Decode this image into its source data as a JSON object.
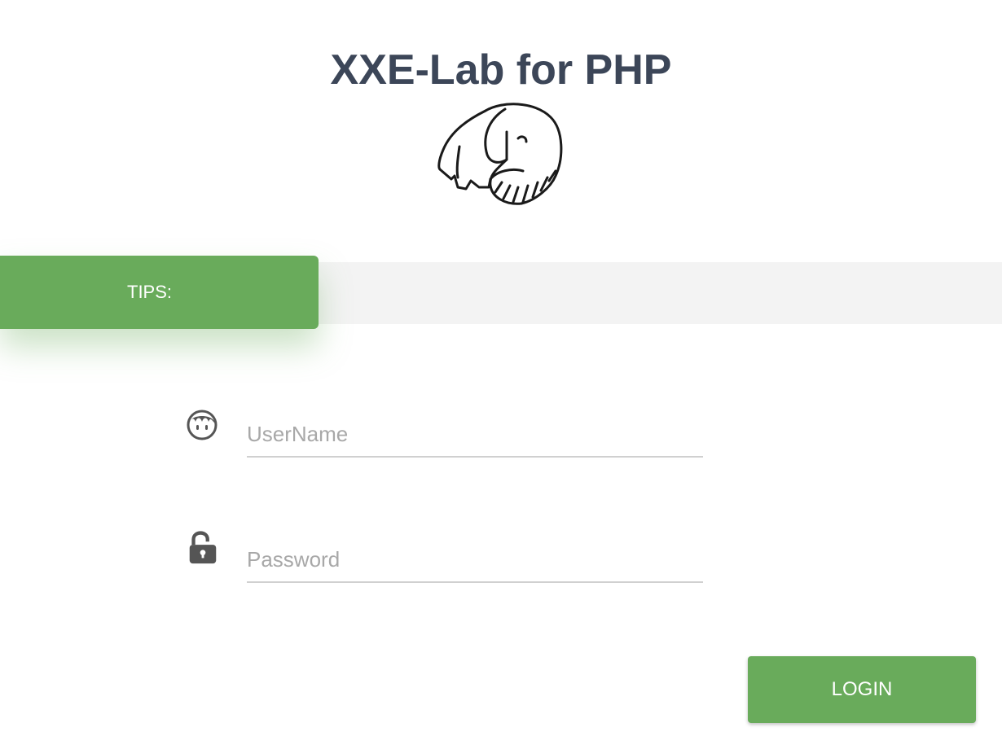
{
  "header": {
    "title": "XXE-Lab for PHP",
    "logo_icon": "php-elephant-icon"
  },
  "tips": {
    "label": "TIPS:",
    "text": ""
  },
  "form": {
    "username": {
      "icon": "user-face-icon",
      "placeholder": "UserName",
      "value": ""
    },
    "password": {
      "icon": "unlocked-padlock-icon",
      "placeholder": "Password",
      "value": ""
    },
    "login_label": "LOGIN"
  },
  "colors": {
    "accent": "#69ab5b",
    "title": "#3c4658",
    "tips_band": "#f3f3f3",
    "icon": "#555555"
  }
}
